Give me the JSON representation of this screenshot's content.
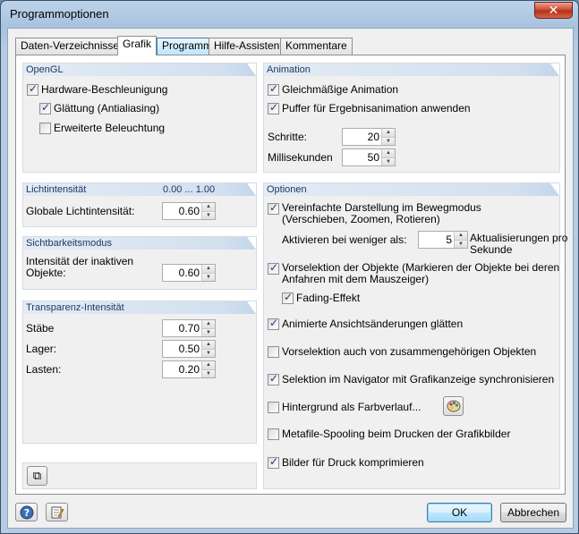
{
  "window": {
    "title": "Programmoptionen",
    "close": "✕"
  },
  "tabs": [
    "Daten-Verzeichnisse",
    "Grafik",
    "Programm",
    "Hilfe-Assistent",
    "Kommentare"
  ],
  "opengl": {
    "header": "OpenGL",
    "hw": "Hardware-Beschleunigung",
    "smooth": "Glättung (Antialiasing)",
    "light": "Erweiterte Beleuchtung"
  },
  "light": {
    "header": "Lichtintensität",
    "range": "0.00 ... 1.00",
    "global_label": "Globale Lichtintensität:",
    "global_value": "0.60"
  },
  "visibility": {
    "header": "Sichtbarkeitsmodus",
    "label": "Intensität der inaktiven\nObjekte:",
    "label1": "Intensität der inaktiven",
    "label2": "Objekte:",
    "value": "0.60"
  },
  "transparency": {
    "header": "Transparenz-Intensität",
    "rows": [
      {
        "label": "Stäbe",
        "value": "0.70"
      },
      {
        "label": "Lager:",
        "value": "0.50"
      },
      {
        "label": "Lasten:",
        "value": "0.20"
      }
    ]
  },
  "animation": {
    "header": "Animation",
    "smooth": "Gleichmäßige Animation",
    "buffer": "Puffer für Ergebnisanimation anwenden",
    "steps_label": "Schritte:",
    "steps_value": "20",
    "ms_label": "Millisekunden",
    "ms_value": "50"
  },
  "options": {
    "header": "Optionen",
    "simplified1": "Vereinfachte Darstellung im Bewegmodus",
    "simplified2": "(Verschieben, Zoomen, Rotieren)",
    "activate_label": "Aktivieren bei weniger als:",
    "activate_value": "5",
    "activate_unit1": "Aktualisierungen pro",
    "activate_unit2": "Sekunde",
    "presel1": "Vorselektion der Objekte (Markieren der Objekte bei deren",
    "presel2": "Anfahren mit dem Mauszeiger)",
    "fading": "Fading-Effekt",
    "animated": "Animierte Ansichtsänderungen glätten",
    "presel_related": "Vorselektion auch von zusammengehörigen Objekten",
    "sync": "Selektion im Navigator mit Grafikanzeige synchronisieren",
    "gradient": "Hintergrund als Farbverlauf...",
    "metafile": "Metafile-Spooling beim Drucken der Grafikbilder",
    "compress": "Bilder für Druck komprimieren"
  },
  "footer": {
    "ok": "OK",
    "cancel": "Abbrechen"
  }
}
